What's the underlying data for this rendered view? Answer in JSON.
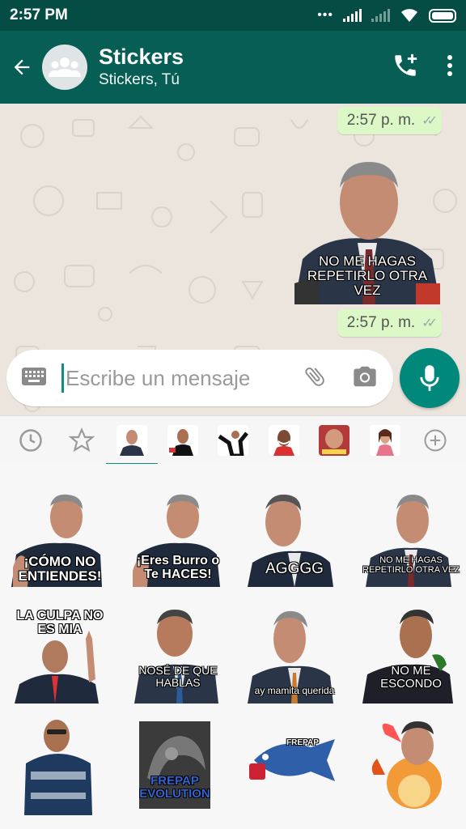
{
  "status_bar": {
    "time": "2:57 PM"
  },
  "header": {
    "title": "Stickers",
    "subtitle": "Stickers, Tú"
  },
  "chat": {
    "time_top": "2:57 p. m.",
    "sticker_caption": "NO ME HAGAS REPETIRLO OTRA VEZ",
    "time_bottom": "2:57 p. m."
  },
  "composer": {
    "placeholder": "Escribe un mensaje"
  },
  "sticker_tray": {
    "tabs": [
      "recent-icon",
      "star-icon",
      "pack-1",
      "pack-2",
      "pack-3",
      "pack-4",
      "pack-5",
      "pack-6",
      "add-icon"
    ],
    "active_tab": "pack-1"
  },
  "stickers": [
    {
      "caption": "¡CÓMO NO ENTIENDES!"
    },
    {
      "caption": "¡Eres Burro o Te HACES!"
    },
    {
      "caption": "AGGGG"
    },
    {
      "caption": "NO ME HAGAS REPETIRLO OTRA VEZ"
    },
    {
      "caption": "LA CULPA NO ES MIA"
    },
    {
      "caption": "NOSÉ DE QUE HABLAS"
    },
    {
      "caption": "ay mamita querida"
    },
    {
      "caption": "NO ME ESCONDO"
    },
    {
      "caption": ""
    },
    {
      "caption": "FREPAP EVOLUTION"
    },
    {
      "caption": "FREPAP"
    },
    {
      "caption": ""
    }
  ],
  "colors": {
    "header": "#075E54",
    "status_bar": "#054D44",
    "bubble": "#DCF8C6",
    "accent": "#00897B",
    "chat_bg": "#ECE5DD"
  }
}
